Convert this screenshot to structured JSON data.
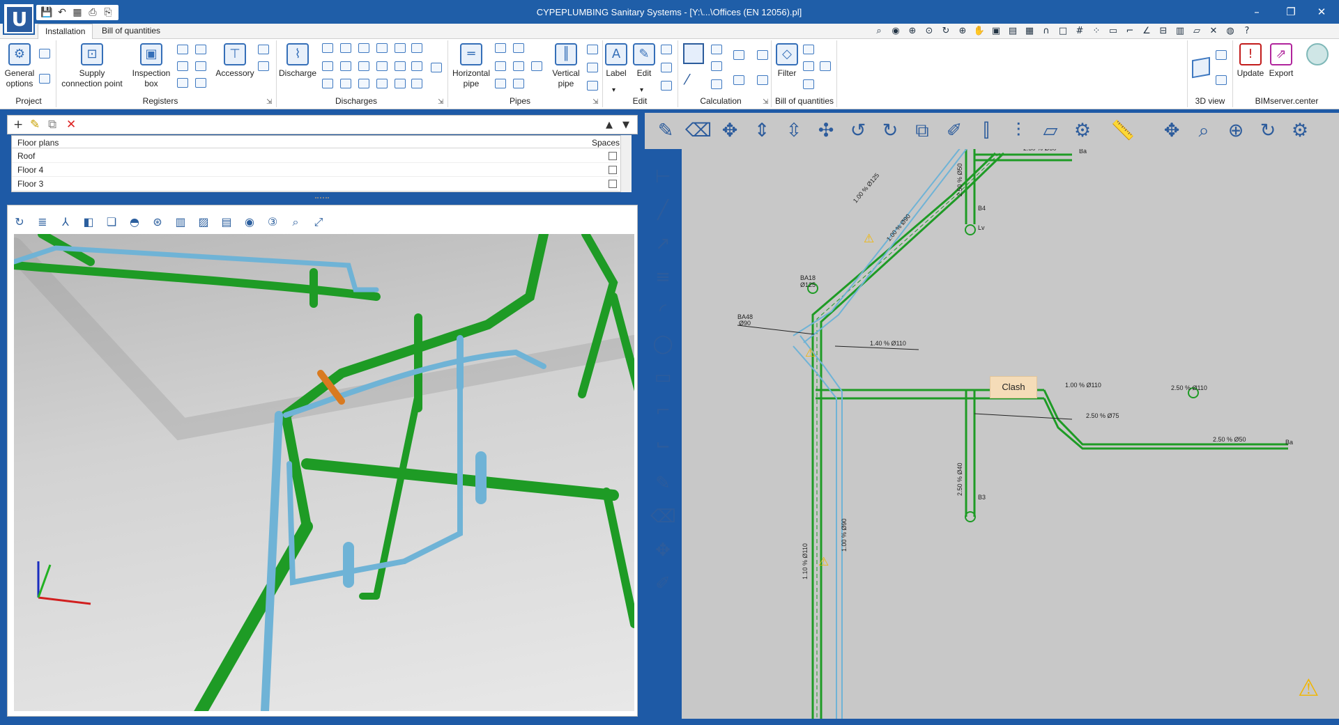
{
  "window": {
    "title": "CYPEPLUMBING Sanitary Systems - [Y:\\...\\Offices (EN 12056).pl]"
  },
  "app": {
    "logo": "U"
  },
  "quick_access": {
    "icons": [
      "save-icon",
      "undo-icon",
      "image-icon",
      "print-icon",
      "print-preview-icon"
    ]
  },
  "window_controls": {
    "minimize": "–",
    "maximize": "❐",
    "close": "✕"
  },
  "tabs": [
    {
      "label": "Installation",
      "active": true
    },
    {
      "label": "Bill of quantities",
      "active": false
    }
  ],
  "ribbon": {
    "groups": [
      {
        "label": "Project"
      },
      {
        "label": "Registers"
      },
      {
        "label": "Discharges"
      },
      {
        "label": "Pipes"
      },
      {
        "label": "Edit"
      },
      {
        "label": "Calculation"
      },
      {
        "label": "Bill of quantities"
      },
      {
        "label": "3D view"
      },
      {
        "label": "BIMserver.center"
      }
    ],
    "buttons": {
      "general_options": "General options",
      "supply_connection_point": "Supply connection point",
      "inspection_box": "Inspection box",
      "accessory": "Accessory",
      "discharge": "Discharge",
      "horizontal_pipe": "Horizontal pipe",
      "vertical_pipe": "Vertical pipe",
      "label": "Label",
      "edit": "Edit",
      "filter": "Filter",
      "update": "Update",
      "export": "Export"
    }
  },
  "floor_plans": {
    "header": "Floor plans",
    "spaces_header": "Spaces",
    "rows": [
      {
        "name": "Roof",
        "spaces": false
      },
      {
        "name": "Floor 4",
        "spaces": false
      },
      {
        "name": "Floor 3",
        "spaces": false
      }
    ]
  },
  "plan": {
    "labels": {
      "p1": "2.50 % Ø50",
      "p2": "Ba",
      "p3": "2.50 % Ø50",
      "p4": "B4",
      "p5": "Lv",
      "p6": "1.00 % Ø125",
      "p7": "1.00 % Ø90",
      "p8": "BA18",
      "p9": "Ø125",
      "p10": "BA48",
      "p11": "Ø90",
      "p12": "1.40 % Ø110",
      "p13": "1.00 % Ø110",
      "p14": "2.50 % Ø110",
      "p15": "2.50 % Ø75",
      "p16": "2.50 % Ø50",
      "p17": "Ba",
      "p18": "2.50 % Ø40",
      "p19": "B3",
      "p20": "1.10 % Ø110",
      "p21": "1.00 % Ø90"
    },
    "tooltip": "Clash"
  },
  "colors": {
    "title_bar": "#1f5ea8",
    "pipe_green": "#1e9b25",
    "pipe_blue": "#6fb3d6",
    "warning": "#f2b600",
    "plan_bg": "#c8c8c8"
  }
}
